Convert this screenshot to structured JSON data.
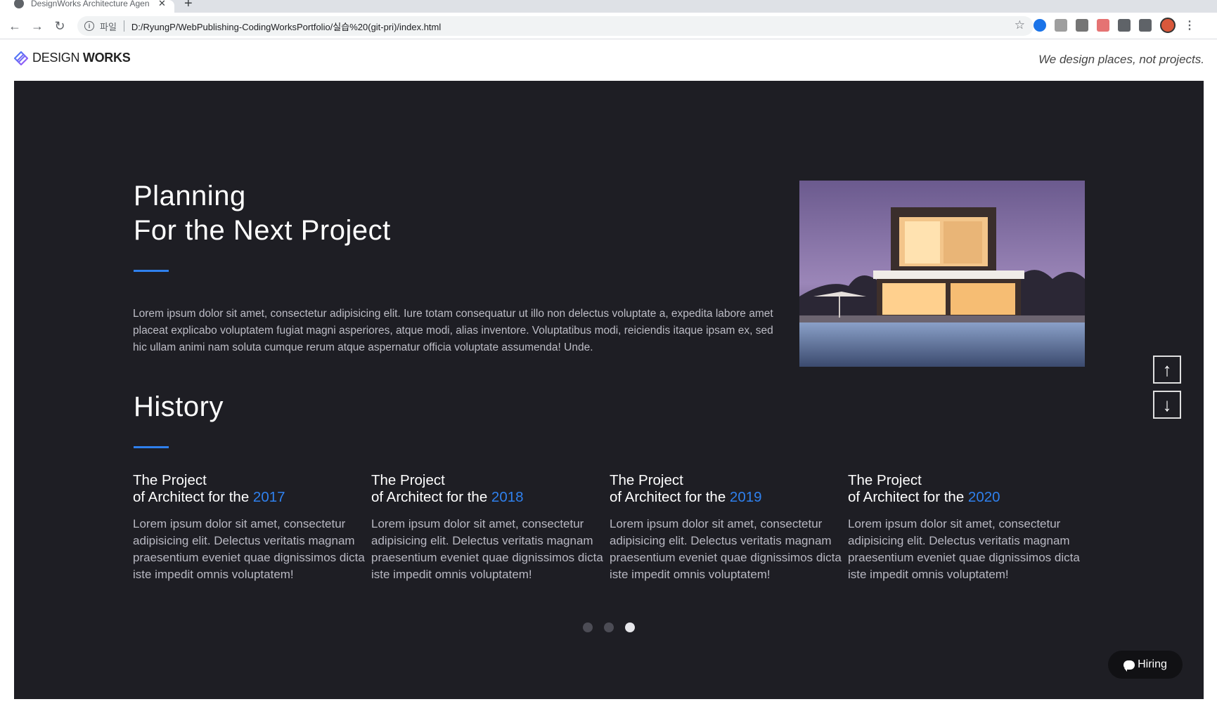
{
  "browser": {
    "tab_title": "DesignWorks Architecture Agen",
    "tab_close": "✕",
    "new_tab": "+",
    "scheme_label": "파일",
    "url": "D:/RyungP/WebPublishing-CodingWorksPortfolio/실습%20(git-pri)/index.html",
    "icons": {
      "back": "←",
      "forward": "→",
      "reload": "↻",
      "info": "i",
      "star": "☆",
      "menu": "⋮"
    }
  },
  "header": {
    "logo_light": "DESIGN ",
    "logo_bold": "WORKS",
    "tagline": "We design places, not projects."
  },
  "planning": {
    "title": "Planning\nFor the Next Project",
    "body": "Lorem ipsum dolor sit amet, consectetur adipisicing elit. Iure totam consequatur ut illo non delectus voluptate a, expedita labore amet placeat explicabo voluptatem fugiat magni asperiores, atque modi, alias inventore. Voluptatibus modi, reiciendis itaque ipsam ex, sed hic ullam animi nam soluta cumque rerum atque aspernatur officia voluptate assumenda! Unde."
  },
  "history": {
    "title": "History",
    "cards": [
      {
        "line1": "The Project",
        "line2": "of Architect for the ",
        "year": "2017",
        "body": "Lorem ipsum dolor sit amet, consectetur adipisicing elit. Delectus veritatis magnam praesentium eveniet quae dignissimos dicta iste impedit omnis voluptatem!"
      },
      {
        "line1": "The Project",
        "line2": "of Architect for the ",
        "year": "2018",
        "body": "Lorem ipsum dolor sit amet, consectetur adipisicing elit. Delectus veritatis magnam praesentium eveniet quae dignissimos dicta iste impedit omnis voluptatem!"
      },
      {
        "line1": "The Project",
        "line2": "of Architect for the ",
        "year": "2019",
        "body": "Lorem ipsum dolor sit amet, consectetur adipisicing elit. Delectus veritatis magnam praesentium eveniet quae dignissimos dicta iste impedit omnis voluptatem!"
      },
      {
        "line1": "The Project",
        "line2": "of Architect for the ",
        "year": "2020",
        "body": "Lorem ipsum dolor sit amet, consectetur adipisicing elit. Delectus veritatis magnam praesentium eveniet quae dignissimos dicta iste impedit omnis voluptatem!"
      }
    ],
    "active_dot": 3
  },
  "scroll": {
    "up": "↑",
    "down": "↓"
  },
  "hiring": {
    "label": "Hiring"
  },
  "colors": {
    "accent": "#2f80ed",
    "hero_bg": "#1e1e24"
  }
}
